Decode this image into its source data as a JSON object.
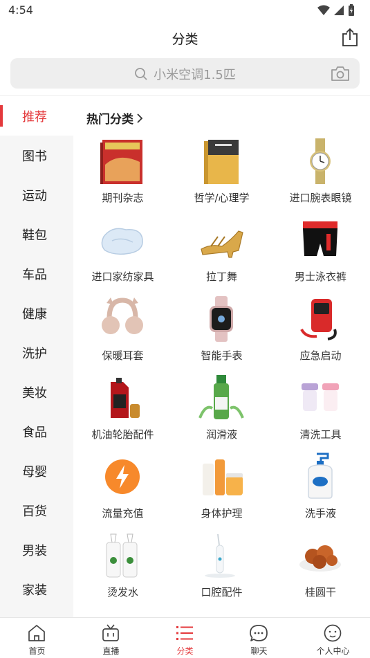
{
  "status_bar": {
    "time": "4:54"
  },
  "header": {
    "title": "分类"
  },
  "search": {
    "placeholder": "小米空调1.5匹"
  },
  "sidebar": {
    "items": [
      {
        "label": "推荐"
      },
      {
        "label": "图书"
      },
      {
        "label": "运动"
      },
      {
        "label": "鞋包"
      },
      {
        "label": "车品"
      },
      {
        "label": "健康"
      },
      {
        "label": "洗护"
      },
      {
        "label": "美妆"
      },
      {
        "label": "食品"
      },
      {
        "label": "母婴"
      },
      {
        "label": "百货"
      },
      {
        "label": "男装"
      },
      {
        "label": "家装"
      }
    ]
  },
  "content": {
    "section_title": "热门分类",
    "categories": [
      {
        "label": "期刊杂志",
        "icon": "magazine-icon"
      },
      {
        "label": "哲学/心理学",
        "icon": "book-icon"
      },
      {
        "label": "进口腕表眼镜",
        "icon": "watch-icon"
      },
      {
        "label": "进口家纺家具",
        "icon": "pillow-icon"
      },
      {
        "label": "拉丁舞",
        "icon": "dance-shoe-icon"
      },
      {
        "label": "男士泳衣裤",
        "icon": "swim-trunks-icon"
      },
      {
        "label": "保暖耳套",
        "icon": "earmuff-icon"
      },
      {
        "label": "智能手表",
        "icon": "smartwatch-icon"
      },
      {
        "label": "应急启动",
        "icon": "jump-starter-icon"
      },
      {
        "label": "机油轮胎配件",
        "icon": "motor-oil-icon"
      },
      {
        "label": "润滑液",
        "icon": "lubricant-icon"
      },
      {
        "label": "清洗工具",
        "icon": "cleaning-cups-icon"
      },
      {
        "label": "流量充值",
        "icon": "lightning-icon"
      },
      {
        "label": "身体护理",
        "icon": "body-care-icon"
      },
      {
        "label": "洗手液",
        "icon": "hand-soap-icon"
      },
      {
        "label": "烫发水",
        "icon": "perm-lotion-icon"
      },
      {
        "label": "口腔配件",
        "icon": "water-flosser-icon"
      },
      {
        "label": "桂圆干",
        "icon": "dried-longan-icon"
      }
    ]
  },
  "tabbar": {
    "tabs": [
      {
        "label": "首页",
        "icon": "home-icon"
      },
      {
        "label": "直播",
        "icon": "tv-icon"
      },
      {
        "label": "分类",
        "icon": "list-icon"
      },
      {
        "label": "聊天",
        "icon": "chat-bubble-icon"
      },
      {
        "label": "个人中心",
        "icon": "profile-face-icon"
      }
    ]
  },
  "colors": {
    "accent": "#e4393c",
    "sidebar_bg": "#f6f6f6",
    "search_bg": "#eeeeee"
  }
}
